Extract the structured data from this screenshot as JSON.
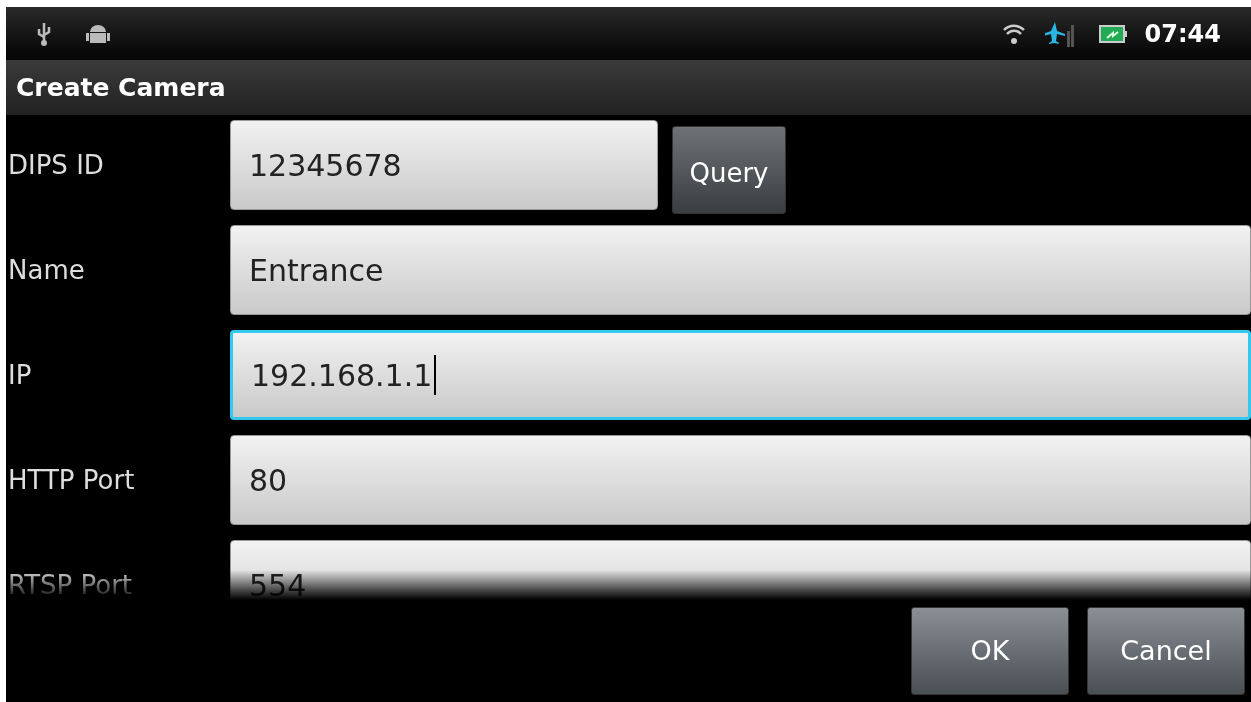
{
  "status_bar": {
    "time": "07:44"
  },
  "title": "Create Camera",
  "fields": [
    {
      "label": "DIPS ID",
      "value": "12345678",
      "focused": false,
      "button": "Query"
    },
    {
      "label": "Name",
      "value": "Entrance",
      "focused": false
    },
    {
      "label": "IP",
      "value": "192.168.1.1",
      "focused": true
    },
    {
      "label": "HTTP Port",
      "value": "80",
      "focused": false
    },
    {
      "label": "RTSP Port",
      "value": "554",
      "focused": false
    }
  ],
  "buttons": [
    "OK",
    "Cancel"
  ]
}
